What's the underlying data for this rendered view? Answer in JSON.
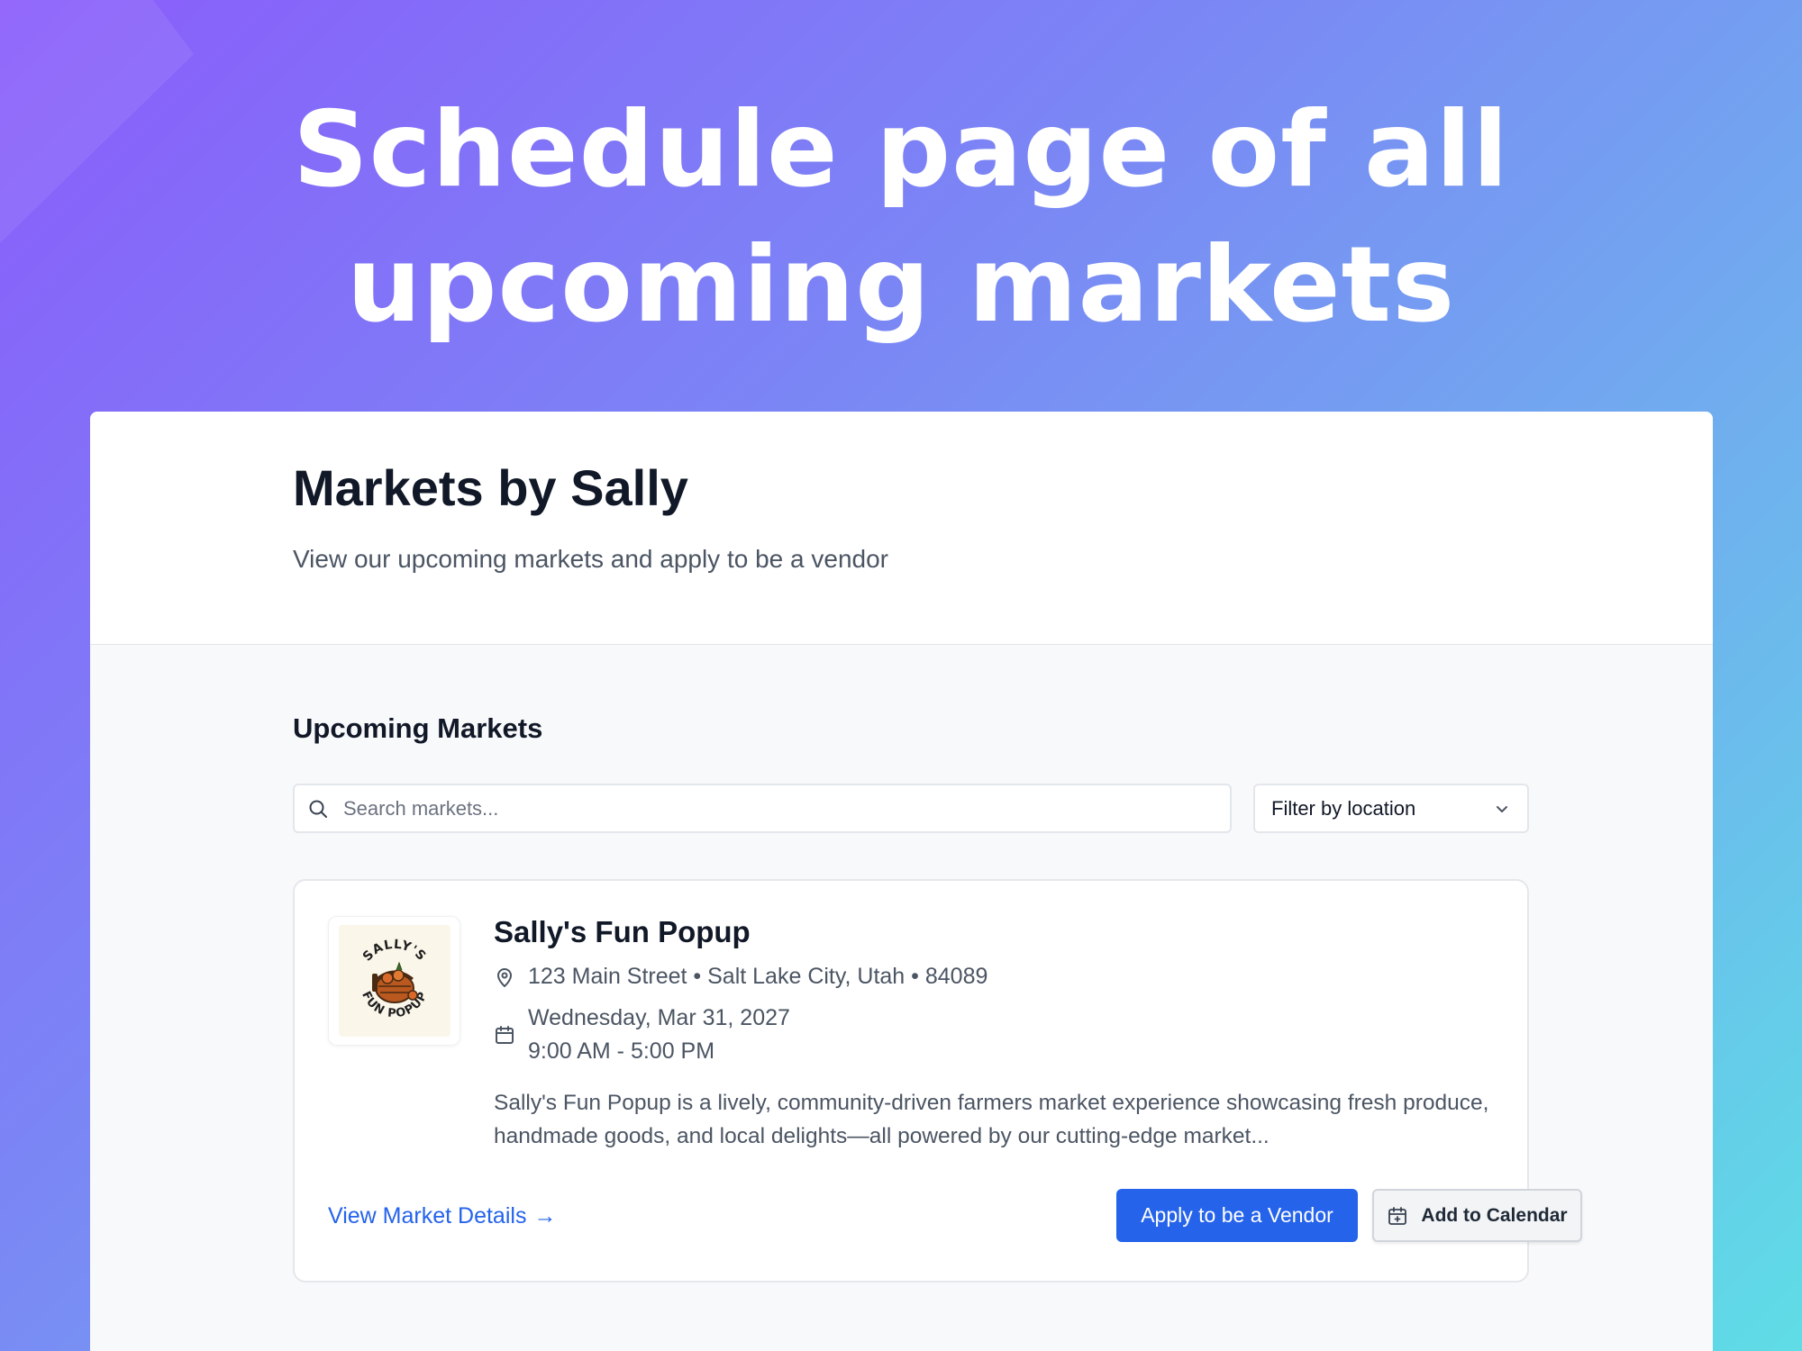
{
  "hero": {
    "title_line1": "Schedule page of all",
    "title_line2": "upcoming markets"
  },
  "header": {
    "title": "Markets by Sally",
    "subtitle": "View our upcoming markets and apply to be a vendor"
  },
  "section": {
    "title": "Upcoming Markets"
  },
  "search": {
    "placeholder": "Search markets...",
    "value": "",
    "icon": "search-icon"
  },
  "filter": {
    "selected": "Filter by location",
    "icon": "chevron-down-icon"
  },
  "markets": [
    {
      "name": "Sally's Fun Popup",
      "logo_text_top": "SALLY'S",
      "logo_text_bottom": "FUN POPUP",
      "address": "123 Main Street • Salt Lake City, Utah • 84089",
      "date": "Wednesday, Mar 31, 2027",
      "time": "9:00 AM - 5:00 PM",
      "description": "Sally's Fun Popup is a lively, community-driven farmers market experience showcasing fresh produce, handmade goods, and local delights—all powered by our cutting-edge market...",
      "details_link": "View Market Details",
      "details_arrow": "→",
      "apply_label": "Apply to be a Vendor",
      "calendar_label": "Add to Calendar"
    }
  ],
  "colors": {
    "primary": "#2563eb",
    "title": "#111827",
    "muted": "#4b5563"
  }
}
